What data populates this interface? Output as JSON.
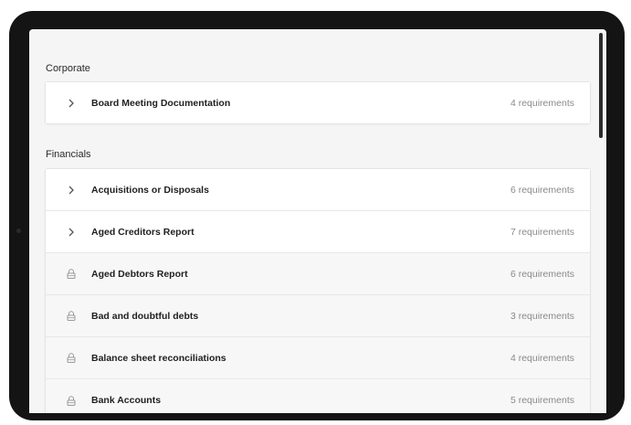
{
  "sections": [
    {
      "title": "Corporate",
      "items": [
        {
          "label": "Board Meeting Documentation",
          "count": "4 requirements",
          "icon": "chevron-right-icon",
          "locked": false
        }
      ]
    },
    {
      "title": "Financials",
      "items": [
        {
          "label": "Acquisitions or Disposals",
          "count": "6 requirements",
          "icon": "chevron-right-icon",
          "locked": false
        },
        {
          "label": "Aged Creditors Report",
          "count": "7 requirements",
          "icon": "chevron-right-icon",
          "locked": false
        },
        {
          "label": "Aged Debtors Report",
          "count": "6 requirements",
          "icon": "lock-icon",
          "locked": true
        },
        {
          "label": "Bad and doubtful debts",
          "count": "3 requirements",
          "icon": "lock-icon",
          "locked": true
        },
        {
          "label": "Balance sheet reconciliations",
          "count": "4 requirements",
          "icon": "lock-icon",
          "locked": true
        },
        {
          "label": "Bank Accounts",
          "count": "5 requirements",
          "icon": "lock-icon",
          "locked": true
        }
      ]
    }
  ],
  "colors": {
    "device_frame": "#141414",
    "screen_bg": "#f5f5f5",
    "card_bg": "#ffffff",
    "locked_row_bg": "#f7f7f7",
    "label_text": "#1f1f1f",
    "count_text": "#8a8a8a"
  }
}
